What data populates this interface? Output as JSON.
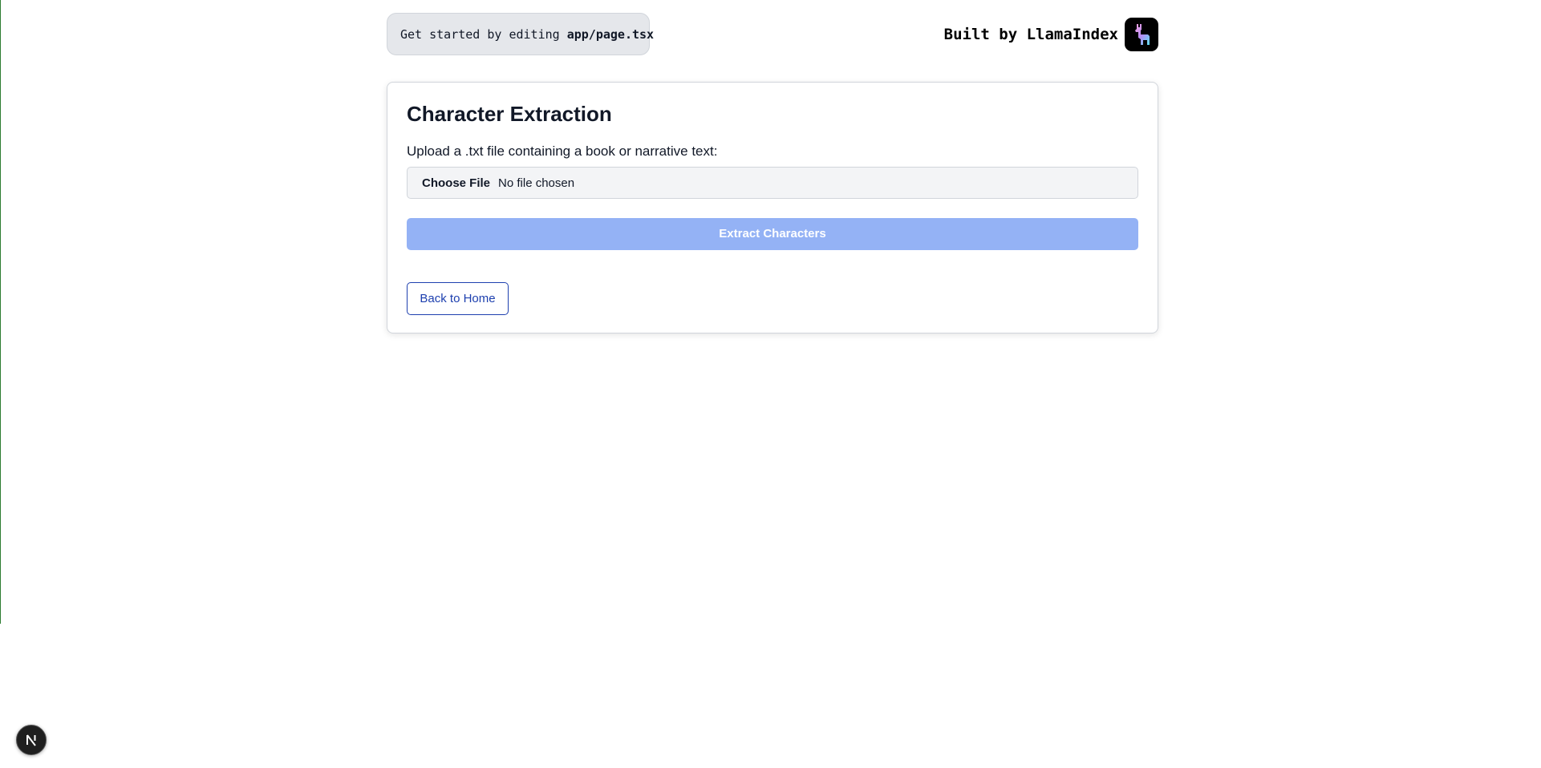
{
  "header": {
    "hint_prefix": "Get started by editing",
    "hint_code": "app/page.tsx",
    "built_by": "Built by LlamaIndex",
    "logo_icon": "llama-icon"
  },
  "card": {
    "title": "Character Extraction",
    "upload_label": "Upload a .txt file containing a book or narrative text:",
    "file_input": {
      "button_label": "Choose File",
      "status": "No file chosen"
    },
    "extract_button": "Extract Characters",
    "back_button": "Back to Home"
  },
  "dev_badge": {
    "icon": "nextjs-icon",
    "letter": "N"
  },
  "colors": {
    "extract_button_disabled": "#94b2f5",
    "back_button_accent": "#1e40af",
    "hint_background": "#e5e7eb"
  }
}
